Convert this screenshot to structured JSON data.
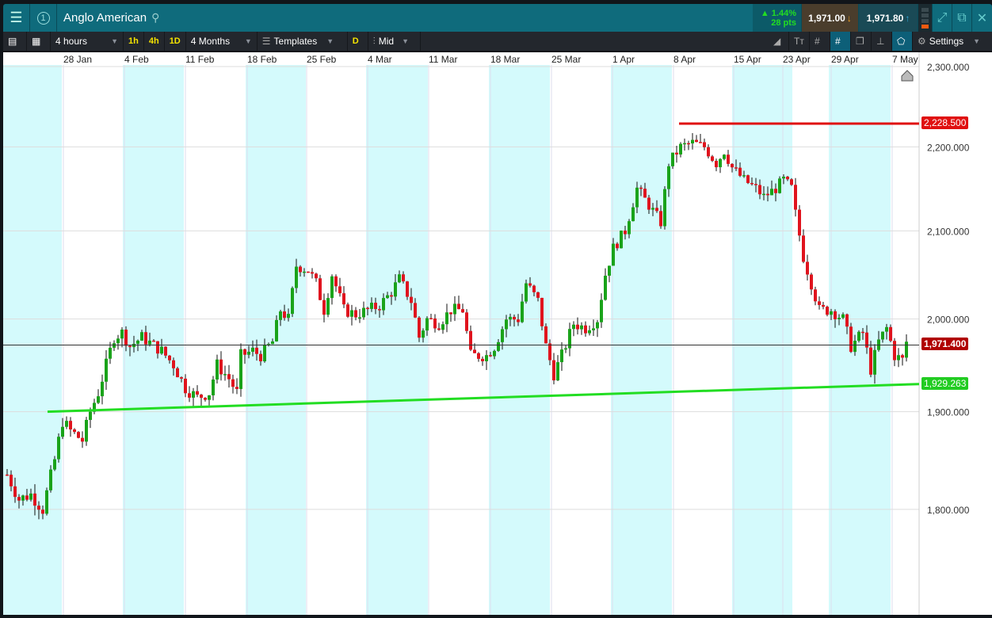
{
  "header": {
    "title": "Anglo American",
    "badge": "1",
    "change_pct": "▲ 1.44%",
    "change_pts": "28 pts",
    "sell": "1,971.00",
    "buy": "1,971.80"
  },
  "toolbar": {
    "interval": "4 hours",
    "quick": [
      "1h",
      "4h",
      "1D"
    ],
    "range": "4 Months",
    "templates": "Templates",
    "d": "D",
    "price_type": "Mid",
    "settings": "Settings"
  },
  "colors": {
    "up": "#1aa31a",
    "down": "#e0141e",
    "band": "#d4fafc",
    "support": "#22dd22",
    "resistance": "#e01010"
  },
  "axis": {
    "dates": [
      "28 Jan",
      "4 Feb",
      "11 Feb",
      "18 Feb",
      "25 Feb",
      "4 Mar",
      "11 Mar",
      "18 Mar",
      "25 Mar",
      "1 Apr",
      "8 Apr",
      "15 Apr",
      "23 Apr",
      "29 Apr",
      "7 May"
    ],
    "prices": [
      "2,300.000",
      "2,200.000",
      "2,100.000",
      "2,000.000",
      "1,900.000",
      "1,800.000"
    ]
  },
  "labels": {
    "resistance": "2,228.500",
    "current": "1,971.400",
    "support": "1,929.263"
  },
  "chart_data": {
    "type": "candlestick",
    "price_ticks": [
      2300,
      2200,
      2100,
      2000,
      1900,
      1800
    ],
    "current": 1971.4,
    "resistance": 2228.5,
    "support_end": 1929.263,
    "support_start": 1900,
    "path_note": "approximate close path as [bar_index, price]",
    "path": [
      [
        1,
        1835
      ],
      [
        4,
        1810
      ],
      [
        7,
        1815
      ],
      [
        10,
        1800
      ],
      [
        13,
        1850
      ],
      [
        15,
        1890
      ],
      [
        17,
        1880
      ],
      [
        20,
        1870
      ],
      [
        22,
        1900
      ],
      [
        24,
        1920
      ],
      [
        26,
        1950
      ],
      [
        28,
        1980
      ],
      [
        30,
        1985
      ],
      [
        32,
        1970
      ],
      [
        35,
        1980
      ],
      [
        40,
        1965
      ],
      [
        43,
        1950
      ],
      [
        46,
        1925
      ],
      [
        49,
        1915
      ],
      [
        52,
        1920
      ],
      [
        54,
        1950
      ],
      [
        57,
        1935
      ],
      [
        59,
        1920
      ],
      [
        60,
        1960
      ],
      [
        63,
        1965
      ],
      [
        65,
        1960
      ],
      [
        68,
        1975
      ],
      [
        70,
        2010
      ],
      [
        72,
        2000
      ],
      [
        74,
        2060
      ],
      [
        77,
        2055
      ],
      [
        79,
        2040
      ],
      [
        81,
        2010
      ],
      [
        83,
        2050
      ],
      [
        86,
        2010
      ],
      [
        89,
        2005
      ],
      [
        92,
        2010
      ],
      [
        95,
        2015
      ],
      [
        98,
        2030
      ],
      [
        100,
        2045
      ],
      [
        103,
        2020
      ],
      [
        105,
        1980
      ],
      [
        107,
        2000
      ],
      [
        110,
        1995
      ],
      [
        113,
        2010
      ],
      [
        116,
        2010
      ],
      [
        118,
        1960
      ],
      [
        122,
        1960
      ],
      [
        124,
        1970
      ],
      [
        127,
        2000
      ],
      [
        130,
        2000
      ],
      [
        132,
        2040
      ],
      [
        135,
        2020
      ],
      [
        137,
        1970
      ],
      [
        139,
        1940
      ],
      [
        141,
        1960
      ],
      [
        144,
        1995
      ],
      [
        147,
        1990
      ],
      [
        150,
        2000
      ],
      [
        152,
        2050
      ],
      [
        154,
        2080
      ],
      [
        157,
        2100
      ],
      [
        160,
        2150
      ],
      [
        163,
        2130
      ],
      [
        166,
        2110
      ],
      [
        168,
        2180
      ],
      [
        171,
        2200
      ],
      [
        174,
        2205
      ],
      [
        177,
        2200
      ],
      [
        180,
        2180
      ],
      [
        182,
        2195
      ],
      [
        184,
        2175
      ],
      [
        187,
        2160
      ],
      [
        190,
        2150
      ],
      [
        192,
        2140
      ],
      [
        195,
        2150
      ],
      [
        197,
        2160
      ],
      [
        199,
        2150
      ],
      [
        200,
        2120
      ],
      [
        202,
        2070
      ],
      [
        204,
        2040
      ],
      [
        206,
        2010
      ],
      [
        209,
        2010
      ],
      [
        212,
        2000
      ],
      [
        214,
        1970
      ],
      [
        217,
        1985
      ],
      [
        219,
        1945
      ],
      [
        221,
        1975
      ],
      [
        223,
        1990
      ],
      [
        225,
        1960
      ],
      [
        227,
        1955
      ],
      [
        228,
        1975
      ]
    ]
  }
}
